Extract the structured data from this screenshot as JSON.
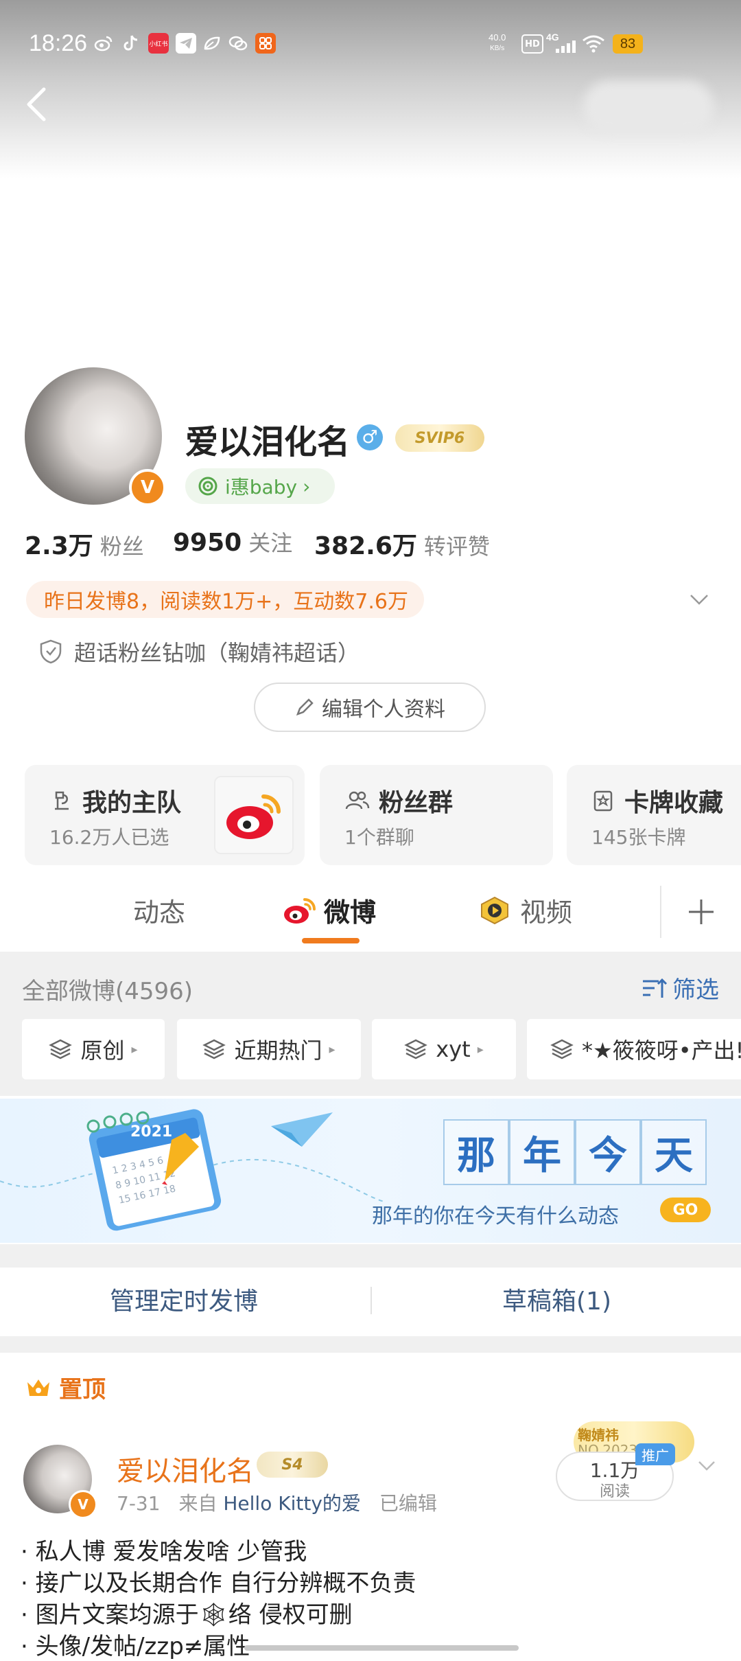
{
  "status_bar": {
    "time": "18:26",
    "speed_top": "40.0",
    "speed_unit": "KB/s",
    "hd": "HD",
    "network": "4G",
    "battery": "83",
    "app_icons": [
      "weibo-icon",
      "tiktok-icon",
      "xiaohongshu-icon",
      "telegram-icon",
      "leaf-icon",
      "wechat-icon",
      "app-grid-icon"
    ],
    "xhs_label": "小红书"
  },
  "profile": {
    "name": "爱以泪化名",
    "svip": "SVIP6",
    "ihui_label": "i惠baby",
    "ihui_arrow": "›",
    "v_mark": "V",
    "gender_symbol": "♂",
    "stats": [
      {
        "value": "2.3万",
        "label": "粉丝"
      },
      {
        "value": "9950",
        "label": "关注"
      },
      {
        "value": "382.6万",
        "label": "转评赞"
      }
    ],
    "summary": "昨日发博8，阅读数1万+，互动数7.6万",
    "supertopic": "超话粉丝钻咖（鞠婧祎超话）",
    "edit_profile": "编辑个人资料"
  },
  "cards": [
    {
      "title": "我的主队",
      "sub": "16.2万人已选"
    },
    {
      "title": "粉丝群",
      "sub": "1个群聊"
    },
    {
      "title": "卡牌收藏",
      "sub": "145张卡牌"
    }
  ],
  "tabs": [
    {
      "label": "动态"
    },
    {
      "label": "微博"
    },
    {
      "label": "视频"
    }
  ],
  "feed": {
    "all_label": "全部微博(4596)",
    "filter_label": "筛选",
    "chips": [
      "原创",
      "近期热门",
      "xyt",
      "*★筱筱呀•产出!"
    ],
    "chip_arrow": "▸"
  },
  "banner": {
    "year": "2021",
    "chars": [
      "那",
      "年",
      "今",
      "天"
    ],
    "subtitle": "那年的你在今天有什么动态",
    "go": "GO"
  },
  "manage": {
    "scheduled": "管理定时发博",
    "drafts": "草稿箱(1)"
  },
  "post": {
    "pinned": "置顶",
    "author": "爱以泪化名",
    "badge": "S4",
    "date": "7-31",
    "from": "来自",
    "source": "Hello Kitty的爱",
    "edited": "已编辑",
    "ad_line1": "鞠婧祎",
    "ad_line2": "NO.2023",
    "reads_value": "1.1万",
    "reads_label": "阅读",
    "promo": "推广",
    "lines": [
      "· 私人博 爱发啥发啥 少管我",
      "· 接广以及长期合作 自行分辨概不负责",
      "· 图片文案均源于🕸络 侵权可删",
      "· 头像/发帖/zzp≠属性"
    ]
  }
}
